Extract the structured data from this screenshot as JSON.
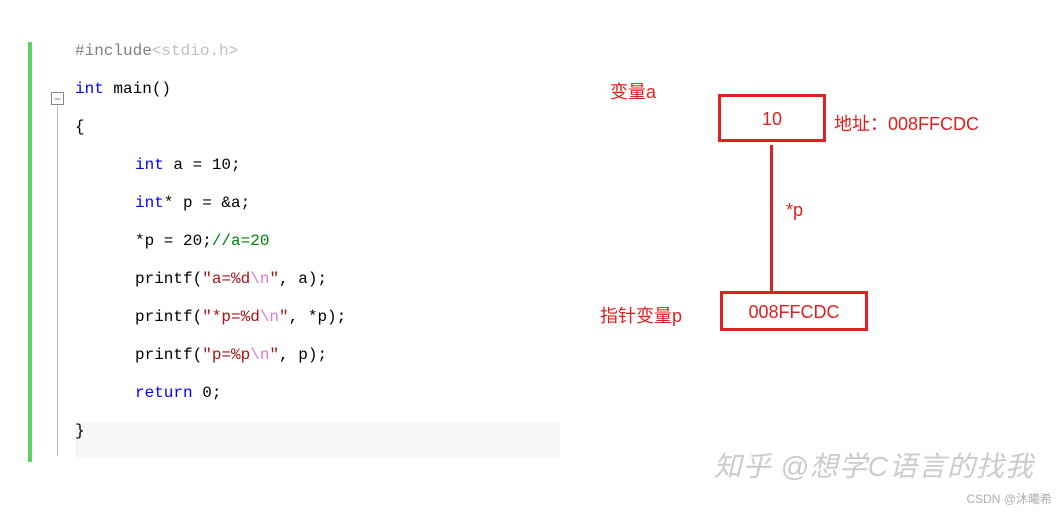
{
  "code": {
    "line1_pre": "#include",
    "line1_inc": "<stdio.h>",
    "line2_kw": "int",
    "line2_rest": " main()",
    "line3": "{",
    "line4_kw": "int",
    "line4_rest": " a = 10;",
    "line5_kw": "int",
    "line5_rest": "* p = &a;",
    "line6_a": "*p = 20;",
    "line6_cmt": "//a=20",
    "line7_a": "printf(",
    "line7_str1": "\"a=%d",
    "line7_esc": "\\n",
    "line7_str2": "\"",
    "line7_b": ", a);",
    "line8_a": "printf(",
    "line8_str1": "\"*p=%d",
    "line8_esc": "\\n",
    "line8_str2": "\"",
    "line8_b": ", *p);",
    "line9_a": "printf(",
    "line9_str1": "\"p=%p",
    "line9_esc": "\\n",
    "line9_str2": "\"",
    "line9_b": ", p);",
    "line10_kw": "return",
    "line10_rest": " 0;",
    "line11": "}"
  },
  "diagram": {
    "var_a_label": "变量a",
    "var_a_value": "10",
    "addr_label": "地址：008FFCDC",
    "deref_label": "*p",
    "var_p_label": "指针变量p",
    "var_p_value": "008FFCDC"
  },
  "watermarks": {
    "zhihu": "知乎 @想学C语言的找我",
    "csdn": "CSDN @沐曦希"
  },
  "fold_icon": "−"
}
